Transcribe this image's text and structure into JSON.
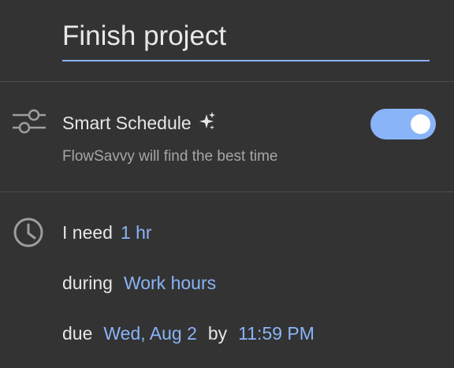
{
  "task": {
    "title": "Finish project"
  },
  "smart_schedule": {
    "label": "Smart Schedule",
    "sparkle": "✦",
    "description": "FlowSavvy will find the best time",
    "enabled": true,
    "toggle_color": "#8ab4f8",
    "icon": "sliders-icon"
  },
  "schedule": {
    "icon": "clock-icon",
    "need_prefix": "I need",
    "duration": "1 hr",
    "during_prefix": "during",
    "hours": "Work hours",
    "due_prefix": "due",
    "due_date": "Wed, Aug 2",
    "by_word": "by",
    "due_time": "11:59 PM"
  },
  "colors": {
    "background": "#333333",
    "accent": "#8ab4f8"
  }
}
